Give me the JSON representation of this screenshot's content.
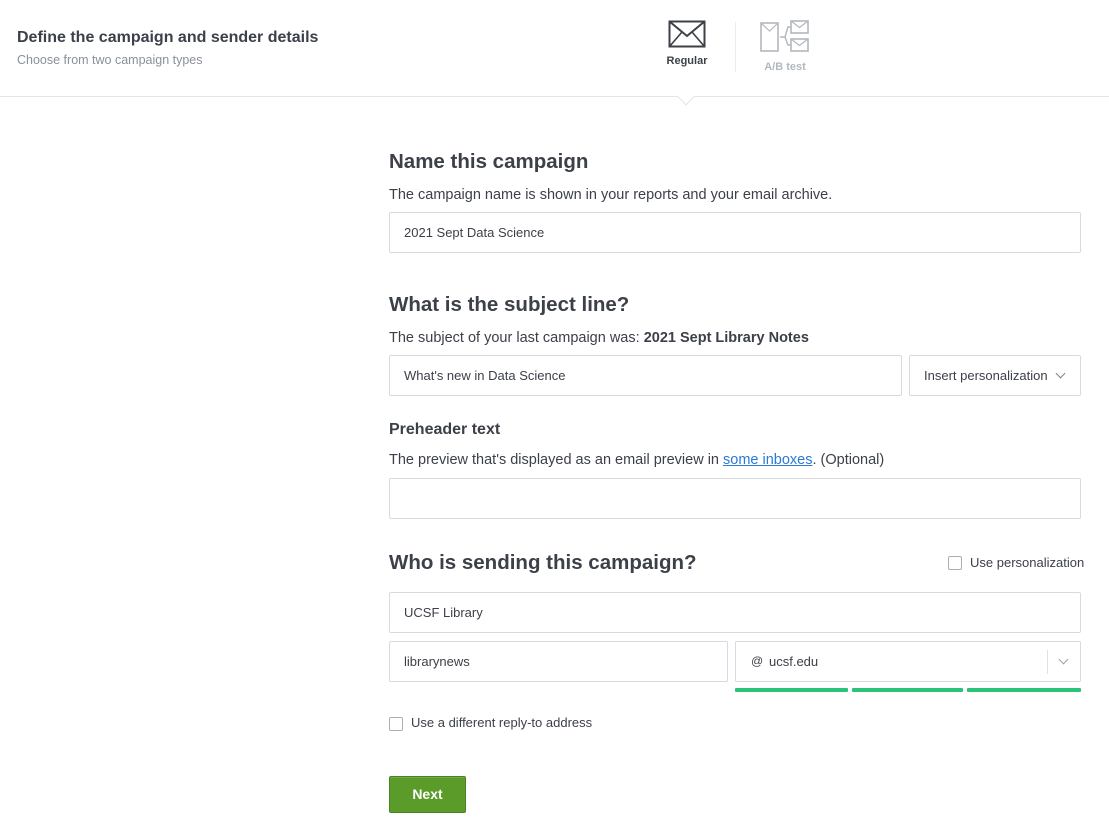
{
  "header": {
    "title": "Define the campaign and sender details",
    "subtitle": "Choose from two campaign types",
    "types": [
      {
        "label": "Regular",
        "icon": "envelope-icon",
        "selected": true
      },
      {
        "label": "A/B test",
        "icon": "ab-test-icon",
        "selected": false
      }
    ]
  },
  "name_section": {
    "title": "Name this campaign",
    "description": "The campaign name is shown in your reports and your email archive.",
    "value": "2021 Sept Data Science"
  },
  "subject_section": {
    "title": "What is the subject line?",
    "description_prefix": "The subject of your last campaign was: ",
    "last_subject": "2021 Sept Library Notes",
    "value": "What's new in Data Science",
    "personalization_label": "Insert personalization"
  },
  "preheader_section": {
    "title": "Preheader text",
    "description_prefix": "The preview that's displayed as an email preview in ",
    "link_text": "some inboxes",
    "description_suffix": ". (Optional)",
    "value": ""
  },
  "sender_section": {
    "title": "Who is sending this campaign?",
    "use_personalization_label": "Use personalization",
    "sender_name": "UCSF Library",
    "sender_local": "librarynews",
    "at_symbol": "@",
    "sender_domain": "ucsf.edu",
    "reply_to_label": "Use a different reply-to address",
    "strength_color": "#2dc27a"
  },
  "actions": {
    "next_label": "Next",
    "next_color": "#5b9b2a"
  }
}
